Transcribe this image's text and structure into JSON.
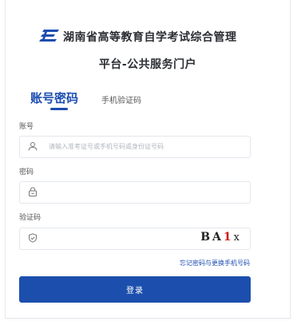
{
  "header": {
    "title_line1": "湖南省高等教育自学考试综合管理",
    "title_line2": "平台-公共服务门户"
  },
  "tabs": [
    {
      "label": "账号密码",
      "active": true
    },
    {
      "label": "手机验证码",
      "active": false
    }
  ],
  "form": {
    "account": {
      "label": "账号",
      "placeholder": "请输入准考证号或手机号码或身份证号码"
    },
    "password": {
      "label": "密码",
      "placeholder": ""
    },
    "captcha": {
      "label": "验证码",
      "placeholder": "",
      "code": [
        "B",
        "A",
        "1",
        "x"
      ]
    }
  },
  "links": {
    "forgot": "忘记密码与更换手机号码"
  },
  "buttons": {
    "login": "登录"
  },
  "colors": {
    "primary": "#1c4fad",
    "captcha_highlight": "#d01b1b"
  }
}
